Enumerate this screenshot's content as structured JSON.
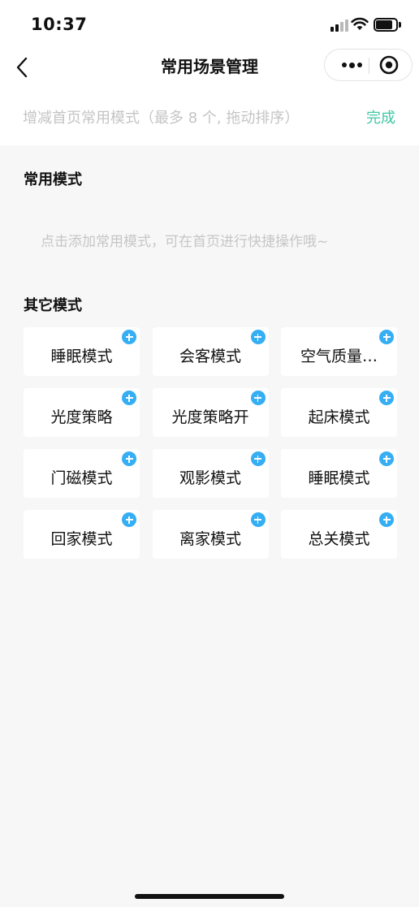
{
  "status_bar": {
    "time": "10:37"
  },
  "nav": {
    "title": "常用场景管理",
    "back_icon": "chevron-left-icon",
    "more_icon": "more-dots-icon",
    "close_icon": "target-circle-icon"
  },
  "toolbar": {
    "hint": "增减首页常用模式（最多 8 个, 拖动排序）",
    "done_label": "完成",
    "accent_color": "#41c7a6"
  },
  "common_section": {
    "title": "常用模式",
    "empty_hint": "点击添加常用模式，可在首页进行快捷操作哦~"
  },
  "other_section": {
    "title": "其它模式",
    "add_icon": "plus-circle-icon",
    "add_color": "#35aef4",
    "modes": [
      {
        "label": "睡眠模式"
      },
      {
        "label": "会客模式"
      },
      {
        "label": "空气质量…"
      },
      {
        "label": "光度策略"
      },
      {
        "label": "光度策略开"
      },
      {
        "label": "起床模式"
      },
      {
        "label": "门磁模式"
      },
      {
        "label": "观影模式"
      },
      {
        "label": "睡眠模式"
      },
      {
        "label": "回家模式"
      },
      {
        "label": "离家模式"
      },
      {
        "label": "总关模式"
      }
    ]
  }
}
